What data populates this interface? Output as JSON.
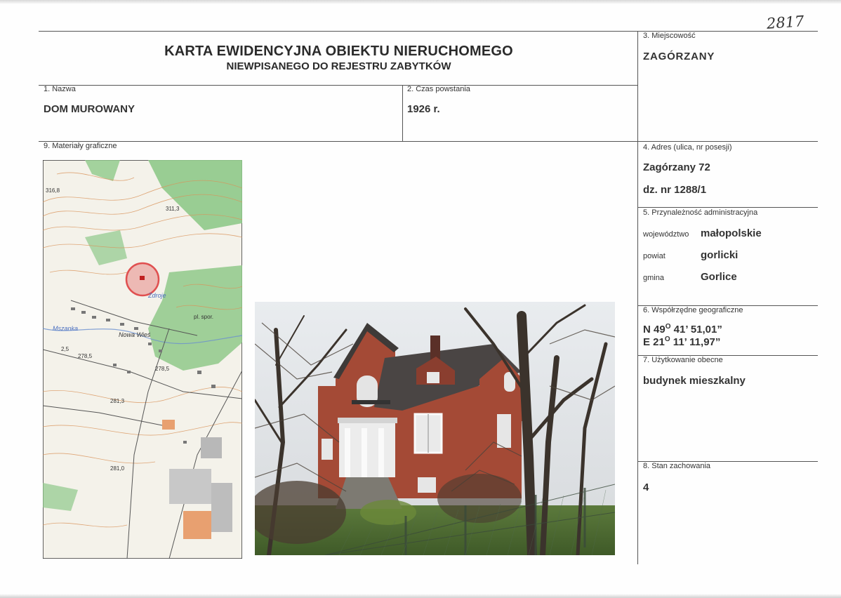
{
  "stamp": "2817",
  "header": {
    "title": "KARTA EWIDENCYJNA OBIEKTU NIERUCHOMEGO",
    "subtitle": "NIEWPISANEGO DO REJESTRU ZABYTKÓW"
  },
  "fields": {
    "nazwa": {
      "label": "1. Nazwa",
      "value": "DOM MUROWANY"
    },
    "czas": {
      "label": "2. Czas powstania",
      "value": "1926 r."
    },
    "miejscowosc": {
      "label": "3. Miejscowość",
      "value": "ZAGÓRZANY"
    },
    "adres": {
      "label": "4. Adres (ulica, nr posesji)",
      "line1": "Zagórzany 72",
      "line2": "dz. nr 1288/1"
    },
    "przynaleznosc": {
      "label": "5. Przynależność administracyjna",
      "woj_label": "województwo",
      "woj_value": "małopolskie",
      "powiat_label": "powiat",
      "powiat_value": "gorlicki",
      "gmina_label": "gmina",
      "gmina_value": "Gorlice"
    },
    "wspolrzedne": {
      "label": "6. Współrzędne geograficzne",
      "n_prefix": "N 49",
      "n_deg": "O",
      "n_rest": " 41’ 51,01”",
      "e_prefix": "E 21",
      "e_deg": "O",
      "e_rest": " 11’ 11,97”"
    },
    "uzytkowanie": {
      "label": "7. Użytkowanie obecne",
      "value": "budynek mieszkalny"
    },
    "stan": {
      "label": "8. Stan zachowania",
      "value": "4"
    },
    "materialy": {
      "label": "9. Materiały graficzne"
    }
  },
  "map_labels": {
    "heights": [
      "316,8",
      "311,3",
      "278,5",
      "278,5",
      "281,3",
      "281,0"
    ],
    "places": [
      "Nowa Wieś",
      "Mszanka",
      "Zdroje"
    ],
    "codes": [
      "2,5",
      "pl. spor."
    ]
  },
  "colors": {
    "line": "#555555",
    "map_green": "#8fc98a",
    "map_contour": "#d9935a",
    "marker": "#e05050",
    "brick": "#a44a36"
  }
}
